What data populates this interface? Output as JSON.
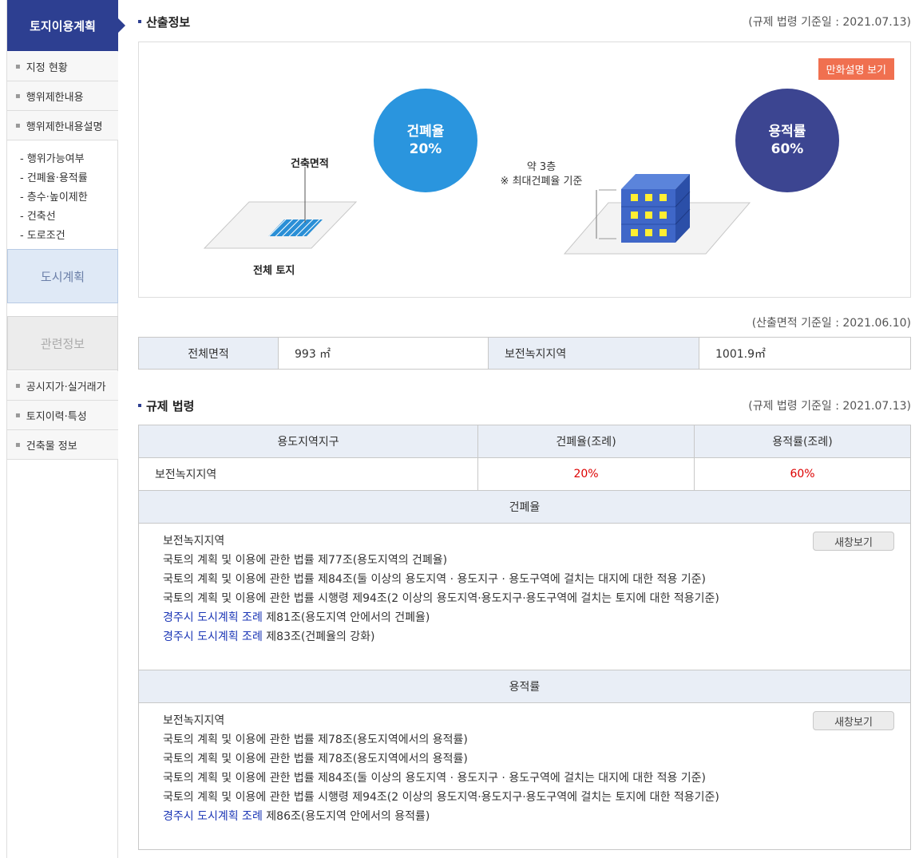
{
  "sidebar": {
    "header": "토지이용계획",
    "items": [
      "지정 현황",
      "행위제한내용",
      "행위제한내용설명"
    ],
    "subitems": [
      "- 행위가능여부",
      "- 건폐율·용적률",
      "- 층수·높이제한",
      "- 건축선",
      "- 도로조건"
    ],
    "city_plan": "도시계획",
    "related": "관련정보",
    "related_items": [
      "공시지가·실거래가",
      "토지이력·특성",
      "건축물 정보"
    ]
  },
  "calc": {
    "title": "산출정보",
    "ref_date": "(규제 법령 기준일 : 2021.07.13)",
    "cartoon_button": "만화설명 보기",
    "coverage_label": "건폐율",
    "coverage_value": "20%",
    "far_label": "용적률",
    "far_value": "60%",
    "floors_text": "약 3층",
    "floors_note": "※ 최대건폐율 기준",
    "building_area_label": "건축면적",
    "total_land_label": "전체 토지"
  },
  "area": {
    "ref_date": "(산출면적 기준일 : 2021.06.10)",
    "total_label": "전체면적",
    "total_value": "993 ㎡",
    "zone_label": "보전녹지지역",
    "zone_value": "1001.9㎡"
  },
  "reg": {
    "title": "규제 법령",
    "ref_date": "(규제 법령 기준일 : 2021.07.13)",
    "col_zone": "용도지역지구",
    "col_coverage": "건폐율(조례)",
    "col_far": "용적률(조례)",
    "row_zone": "보전녹지지역",
    "row_coverage": "20%",
    "row_far": "60%",
    "popup_label": "새창보기",
    "coverage_band": "건폐율",
    "coverage_laws": {
      "zone": "보전녹지지역",
      "line1": "국토의 계획 및 이용에 관한 법률 제77조(용도지역의 건폐율)",
      "line2": "국토의 계획 및 이용에 관한 법률 제84조(둘 이상의 용도지역 · 용도지구 · 용도구역에 걸치는 대지에 대한 적용 기준)",
      "line3": "국토의 계획 및 이용에 관한 법률 시행령 제94조(2 이상의 용도지역·용도지구·용도구역에 걸치는 토지에 대한 적용기준)",
      "ord1_link": "경주시 도시계획 조례",
      "ord1_text": " 제81조(용도지역 안에서의 건폐율)",
      "ord2_link": "경주시 도시계획 조례",
      "ord2_text": " 제83조(건폐율의 강화)"
    },
    "far_band": "용적률",
    "far_laws": {
      "zone": "보전녹지지역",
      "line1": "국토의 계획 및 이용에 관한 법률 제78조(용도지역에서의 용적률)",
      "line2": "국토의 계획 및 이용에 관한 법률 제78조(용도지역에서의 용적률)",
      "line3": "국토의 계획 및 이용에 관한 법률 제84조(둘 이상의 용도지역 · 용도지구 · 용도구역에 걸치는 대지에 대한 적용 기준)",
      "line4": "국토의 계획 및 이용에 관한 법률 시행령 제94조(2 이상의 용도지역·용도지구·용도구역에 걸치는 토지에 대한 적용기준)",
      "ord1_link": "경주시 도시계획 조례",
      "ord1_text": " 제86조(용도지역 안에서의 용적률)"
    }
  },
  "colors": {
    "navy": "#2d3f91",
    "coverage_circle": "#2a95de",
    "far_circle": "#3c4591",
    "cartoon_button": "#f07050",
    "building": "#3f67c8",
    "window": "#ffee33"
  }
}
